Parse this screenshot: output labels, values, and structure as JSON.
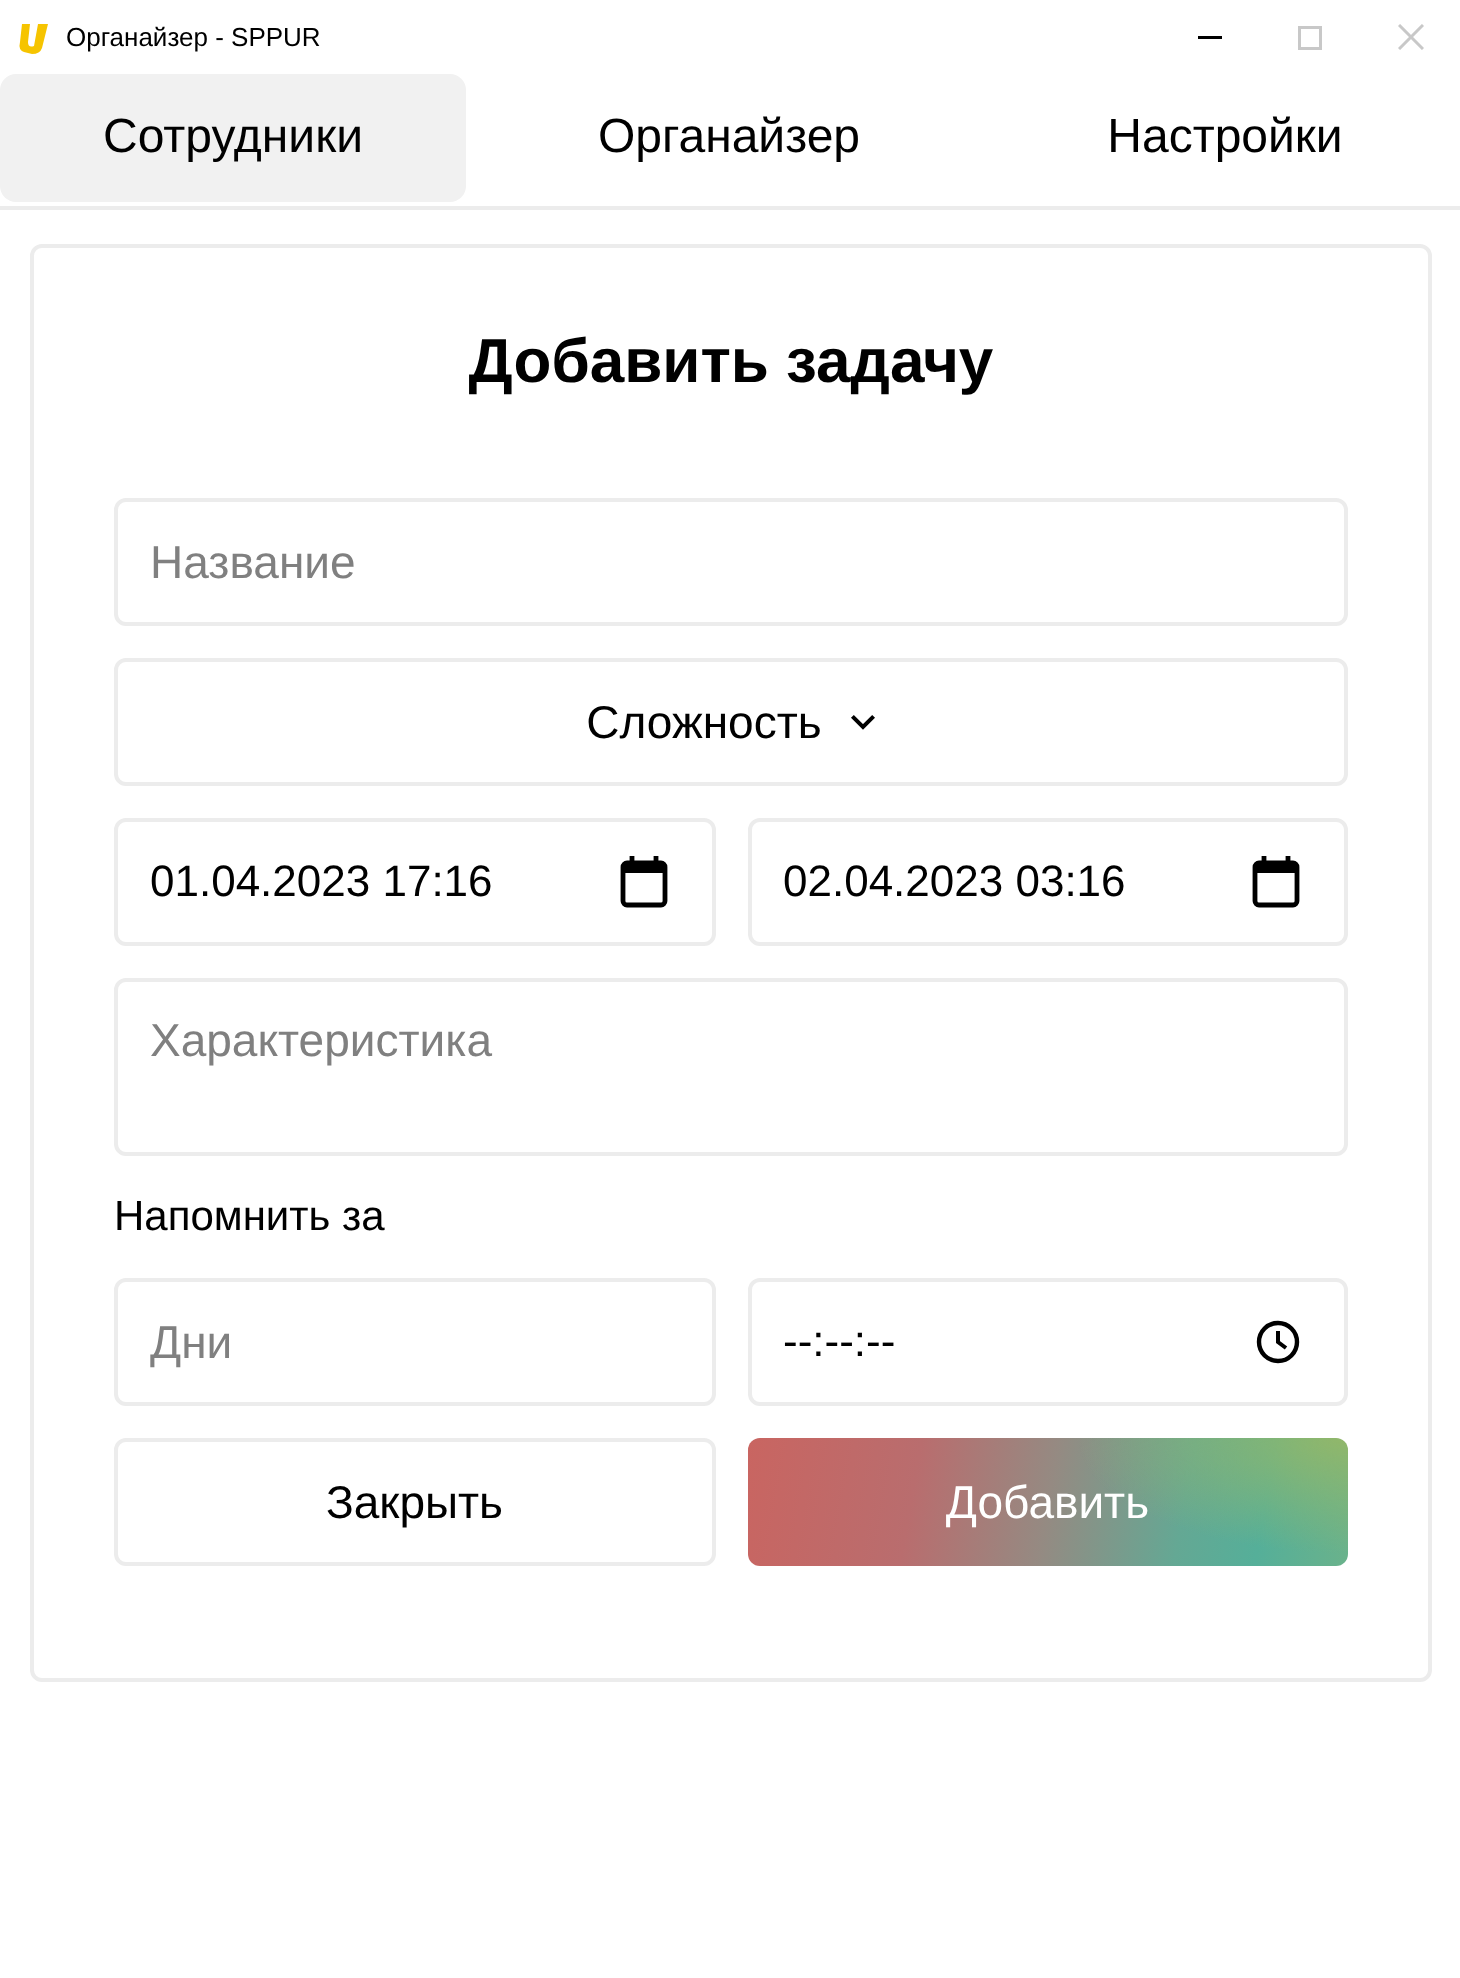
{
  "window": {
    "title": "Органайзер - SPPUR",
    "controls": [
      {
        "kind": "minimize",
        "disabled": false
      },
      {
        "kind": "maximize",
        "disabled": true
      },
      {
        "kind": "close",
        "disabled": true
      }
    ]
  },
  "tabs": [
    {
      "label": "Сотрудники",
      "selected": true
    },
    {
      "label": "Органайзер",
      "selected": false
    },
    {
      "label": "Настройки",
      "selected": false
    }
  ],
  "form": {
    "title": "Добавить задачу",
    "name_field": {
      "placeholder": "Название"
    },
    "difficulty_select": {
      "label": "Сложность"
    },
    "start_datetime": {
      "value": "01.04.2023 17:16"
    },
    "end_datetime": {
      "value": "02.04.2023 03:16"
    },
    "description_field": {
      "placeholder": "Характеристика"
    },
    "remind_label": "Напомнить за",
    "days_field": {
      "placeholder": "Дни"
    },
    "time_field": {
      "value": "--:--:--"
    },
    "buttons": [
      {
        "label": "Закрыть",
        "kind": "secondary"
      },
      {
        "label": "Добавить",
        "kind": "primary"
      }
    ]
  }
}
